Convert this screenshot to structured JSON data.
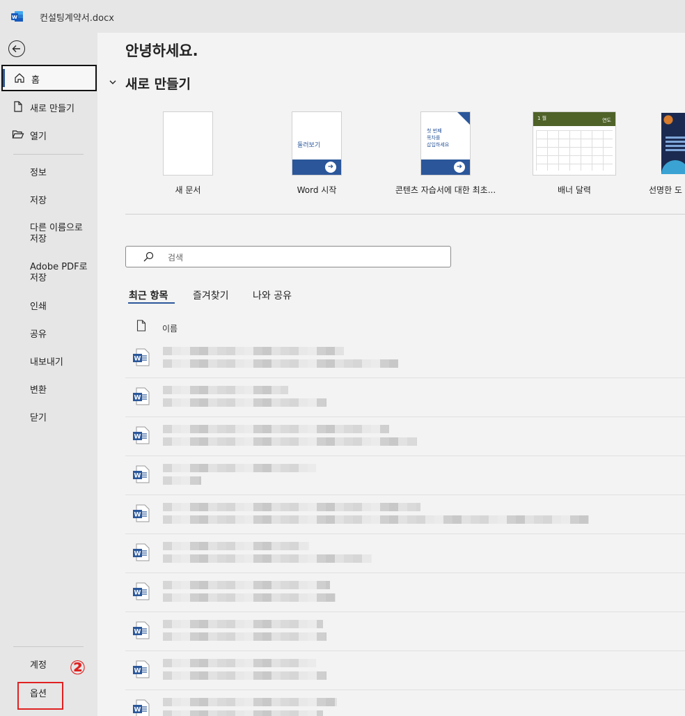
{
  "window": {
    "title": "컨설팅계약서.docx"
  },
  "nav": {
    "home": "홈",
    "new": "새로 만들기",
    "open": "열기",
    "info": "정보",
    "save": "저장",
    "save_as": "다른 이름으로\n저장",
    "save_pdf": "Adobe PDF로\n저장",
    "print": "인쇄",
    "share": "공유",
    "export": "내보내기",
    "transform": "변환",
    "close": "닫기",
    "account": "계정",
    "options": "옵션",
    "step_badge": "②"
  },
  "main": {
    "greeting": "안녕하세요.",
    "new_heading": "새로 만들기",
    "templates": [
      {
        "label": "새 문서"
      },
      {
        "label": "Word 시작",
        "thumb_text": "둘러보기"
      },
      {
        "label": "콘텐츠 자습서에 대한 최초...",
        "thumb_text": "첫 번째\n목차를\n삽입하세요"
      },
      {
        "label": "배너 달력",
        "month": "1 월",
        "year": "연도"
      },
      {
        "label": "선명한 도"
      }
    ],
    "search_placeholder": "검색",
    "tabs": [
      "최근 항목",
      "즐겨찾기",
      "나와 공유"
    ],
    "column_name": "이름",
    "recent_file_count": 10
  },
  "colors": {
    "accent": "#2b579a",
    "highlight": "#e02020"
  },
  "icons": [
    "word-logo-icon",
    "back-arrow-icon",
    "home-icon",
    "new-document-icon",
    "folder-open-icon",
    "search-icon",
    "document-icon",
    "word-file-icon",
    "chevron-down-icon"
  ]
}
